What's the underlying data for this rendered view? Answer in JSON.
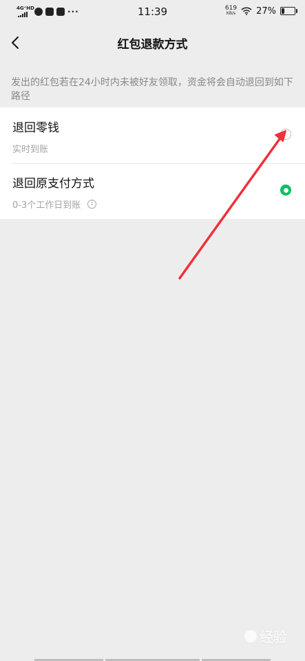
{
  "status_bar": {
    "network_label": "4G⁺HD",
    "time": "11:39",
    "net_speed_value": "619",
    "net_speed_unit": "KB/s",
    "battery_percent": "27%",
    "battery_level": 0.27
  },
  "nav": {
    "title": "红包退款方式"
  },
  "description": "发出的红包若在24小时内未被好友领取，资金将会自动退回到如下路径",
  "options": [
    {
      "title": "退回零钱",
      "subtitle": "实时到账",
      "selected": false
    },
    {
      "title": "退回原支付方式",
      "subtitle": "0-3个工作日到账",
      "selected": true
    }
  ],
  "colors": {
    "background": "#ededed",
    "accent_green": "#07c160",
    "annotation_red": "#f0303a"
  },
  "watermark": {
    "text": "经验"
  }
}
